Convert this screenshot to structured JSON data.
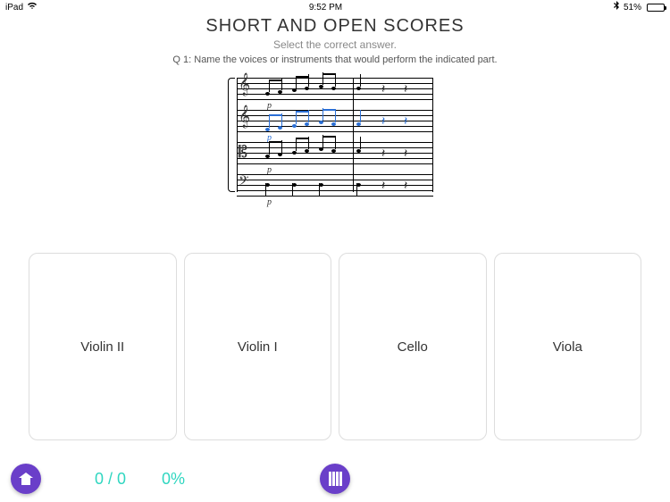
{
  "status": {
    "device": "iPad",
    "time": "9:52 PM",
    "battery_pct": "51%"
  },
  "header": {
    "title": "SHORT AND OPEN SCORES",
    "subtitle": "Select the correct answer.",
    "question": "Q 1: Name the voices or instruments that would perform the indicated part."
  },
  "answers": [
    {
      "label": "Violin II"
    },
    {
      "label": "Violin I"
    },
    {
      "label": "Cello"
    },
    {
      "label": "Viola"
    }
  ],
  "footer": {
    "score": "0 / 0",
    "percent": "0%"
  },
  "icons": {
    "home": "home-icon",
    "piano": "piano-icon",
    "wifi": "wifi-icon",
    "bluetooth": "bluetooth-icon"
  }
}
